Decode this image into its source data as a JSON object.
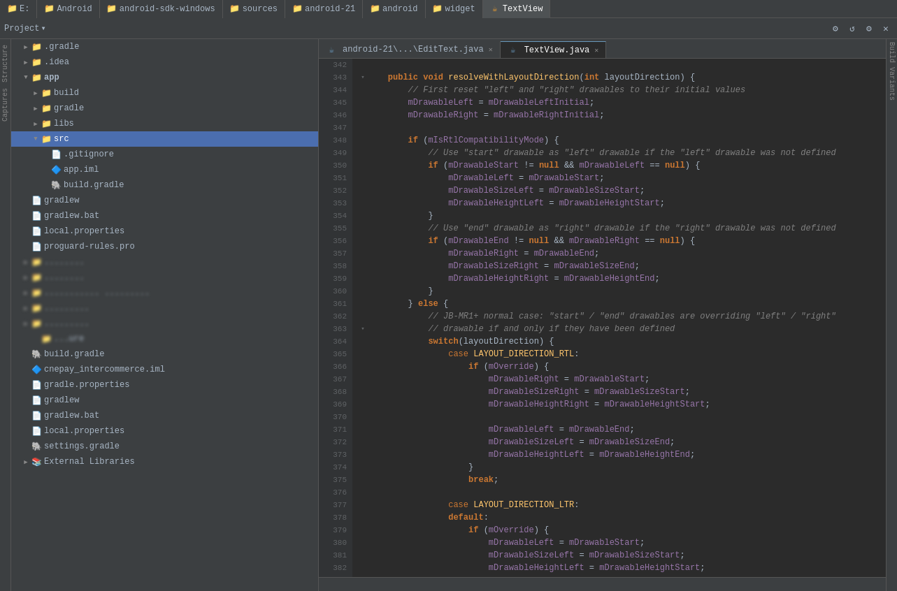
{
  "topTabs": [
    {
      "id": "e",
      "label": "E:",
      "icon": "android-folder-icon",
      "active": false,
      "closeable": false
    },
    {
      "id": "android",
      "label": "Android",
      "icon": "android-folder-icon",
      "active": false,
      "closeable": false
    },
    {
      "id": "android-sdk-windows",
      "label": "android-sdk-windows",
      "icon": "android-folder-icon",
      "active": false,
      "closeable": false
    },
    {
      "id": "sources",
      "label": "sources",
      "icon": "android-folder-icon",
      "active": false,
      "closeable": false
    },
    {
      "id": "android-21",
      "label": "android-21",
      "icon": "android-folder-icon",
      "active": false,
      "closeable": false
    },
    {
      "id": "android2",
      "label": "android",
      "icon": "android-folder-icon",
      "active": false,
      "closeable": false
    },
    {
      "id": "widget",
      "label": "widget",
      "icon": "android-folder-icon",
      "active": false,
      "closeable": false
    },
    {
      "id": "textview-main",
      "label": "TextView",
      "icon": "textview-icon",
      "active": true,
      "closeable": false
    }
  ],
  "toolbar": {
    "project_label": "Project",
    "dropdown_arrow": "▾",
    "icons": [
      "⚙",
      "↺",
      "⚙",
      "✕"
    ]
  },
  "editorTabs": [
    {
      "id": "edittext",
      "label": "android-21\\...\\EditText.java",
      "icon": "☕",
      "active": false,
      "closeable": true
    },
    {
      "id": "textview",
      "label": "TextView.java",
      "icon": "☕",
      "active": true,
      "closeable": true
    }
  ],
  "fileTree": {
    "items": [
      {
        "level": 1,
        "type": "folder",
        "name": ".gradle",
        "expanded": false,
        "icon": "folder"
      },
      {
        "level": 1,
        "type": "folder",
        "name": ".idea",
        "expanded": false,
        "icon": "folder"
      },
      {
        "level": 1,
        "type": "folder",
        "name": "app",
        "expanded": true,
        "icon": "folder",
        "bold": true
      },
      {
        "level": 2,
        "type": "folder",
        "name": "build",
        "expanded": false,
        "icon": "folder"
      },
      {
        "level": 2,
        "type": "folder",
        "name": "gradle",
        "expanded": false,
        "icon": "folder"
      },
      {
        "level": 2,
        "type": "folder",
        "name": "libs",
        "expanded": false,
        "icon": "folder"
      },
      {
        "level": 2,
        "type": "folder",
        "name": "src",
        "expanded": true,
        "icon": "folder-src",
        "selected": true
      },
      {
        "level": 3,
        "type": "file",
        "name": ".gitignore",
        "icon": "file"
      },
      {
        "level": 3,
        "type": "file",
        "name": "app.iml",
        "icon": "module"
      },
      {
        "level": 3,
        "type": "file",
        "name": "build.gradle",
        "icon": "gradle"
      },
      {
        "level": 1,
        "type": "file",
        "name": "gradlew",
        "icon": "file"
      },
      {
        "level": 1,
        "type": "file",
        "name": "gradlew.bat",
        "icon": "file"
      },
      {
        "level": 1,
        "type": "file",
        "name": "local.properties",
        "icon": "file"
      },
      {
        "level": 1,
        "type": "file",
        "name": "proguard-rules.pro",
        "icon": "file"
      },
      {
        "level": 1,
        "type": "folder",
        "name": "...",
        "expanded": false,
        "icon": "folder"
      },
      {
        "level": 1,
        "type": "folder",
        "name": "...",
        "expanded": false,
        "icon": "folder"
      },
      {
        "level": 1,
        "type": "folder",
        "name": "...",
        "expanded": false,
        "icon": "folder"
      },
      {
        "level": 1,
        "type": "folder",
        "name": "...",
        "expanded": false,
        "icon": "folder"
      },
      {
        "level": 1,
        "type": "folder",
        "name": "...",
        "expanded": false,
        "icon": "folder"
      },
      {
        "level": 2,
        "type": "folder",
        "name": "...ure",
        "expanded": false,
        "icon": "folder"
      },
      {
        "level": 1,
        "type": "file",
        "name": "build.gradle",
        "icon": "gradle"
      },
      {
        "level": 1,
        "type": "file",
        "name": "cnepay_intercommerce.iml",
        "icon": "module"
      },
      {
        "level": 1,
        "type": "file",
        "name": "gradle.properties",
        "icon": "file"
      },
      {
        "level": 1,
        "type": "file",
        "name": "gradlew",
        "icon": "file"
      },
      {
        "level": 1,
        "type": "file",
        "name": "gradlew.bat",
        "icon": "file"
      },
      {
        "level": 1,
        "type": "file",
        "name": "local.properties",
        "icon": "file"
      },
      {
        "level": 1,
        "type": "file",
        "name": "settings.gradle",
        "icon": "gradle"
      },
      {
        "level": 0,
        "type": "folder",
        "name": "External Libraries",
        "expanded": false,
        "icon": "folder"
      }
    ]
  },
  "codeLines": [
    {
      "num": 342,
      "fold": "",
      "content": ""
    },
    {
      "num": 343,
      "fold": "▾",
      "content": "    public void resolveWithLayoutDirection(int layoutDirection) {"
    },
    {
      "num": 344,
      "fold": "",
      "content": "        // First reset \"left\" and \"right\" drawables to their initial values"
    },
    {
      "num": 345,
      "fold": "",
      "content": "        mDrawableLeft = mDrawableLeftInitial;"
    },
    {
      "num": 346,
      "fold": "",
      "content": "        mDrawableRight = mDrawableRightInitial;"
    },
    {
      "num": 347,
      "fold": "",
      "content": ""
    },
    {
      "num": 348,
      "fold": "",
      "content": "        if (mIsRtlCompatibilityMode) {"
    },
    {
      "num": 349,
      "fold": "",
      "content": "            // Use \"start\" drawable as \"left\" drawable if the \"left\" drawable was not defined"
    },
    {
      "num": 350,
      "fold": "",
      "content": "            if (mDrawableStart != null && mDrawableLeft == null) {"
    },
    {
      "num": 351,
      "fold": "",
      "content": "                mDrawableLeft = mDrawableStart;"
    },
    {
      "num": 352,
      "fold": "",
      "content": "                mDrawableSizeLeft = mDrawableSizeStart;"
    },
    {
      "num": 353,
      "fold": "",
      "content": "                mDrawableHeightLeft = mDrawableHeightStart;"
    },
    {
      "num": 354,
      "fold": "",
      "content": "            }"
    },
    {
      "num": 355,
      "fold": "",
      "content": "            // Use \"end\" drawable as \"right\" drawable if the \"right\" drawable was not defined"
    },
    {
      "num": 356,
      "fold": "",
      "content": "            if (mDrawableEnd != null && mDrawableRight == null) {"
    },
    {
      "num": 357,
      "fold": "",
      "content": "                mDrawableRight = mDrawableEnd;"
    },
    {
      "num": 358,
      "fold": "",
      "content": "                mDrawableSizeRight = mDrawableSizeEnd;"
    },
    {
      "num": 359,
      "fold": "",
      "content": "                mDrawableHeightRight = mDrawableHeightEnd;"
    },
    {
      "num": 360,
      "fold": "",
      "content": "            }"
    },
    {
      "num": 361,
      "fold": "",
      "content": "        } else {"
    },
    {
      "num": 362,
      "fold": "",
      "content": "            // JB-MR1+ normal case: \"start\" / \"end\" drawables are overriding \"left\" / \"right\""
    },
    {
      "num": 363,
      "fold": "▾",
      "content": "            // drawable if and only if they have been defined"
    },
    {
      "num": 364,
      "fold": "",
      "content": "            switch(layoutDirection) {"
    },
    {
      "num": 365,
      "fold": "",
      "content": "                case LAYOUT_DIRECTION_RTL:"
    },
    {
      "num": 366,
      "fold": "",
      "content": "                    if (mOverride) {"
    },
    {
      "num": 367,
      "fold": "",
      "content": "                        mDrawableRight = mDrawableStart;"
    },
    {
      "num": 368,
      "fold": "",
      "content": "                        mDrawableSizeRight = mDrawableSizeStart;"
    },
    {
      "num": 369,
      "fold": "",
      "content": "                        mDrawableHeightRight = mDrawableHeightStart;"
    },
    {
      "num": 370,
      "fold": "",
      "content": ""
    },
    {
      "num": 371,
      "fold": "",
      "content": "                        mDrawableLeft = mDrawableEnd;"
    },
    {
      "num": 372,
      "fold": "",
      "content": "                        mDrawableSizeLeft = mDrawableSizeEnd;"
    },
    {
      "num": 373,
      "fold": "",
      "content": "                        mDrawableHeightLeft = mDrawableHeightEnd;"
    },
    {
      "num": 374,
      "fold": "",
      "content": "                    }"
    },
    {
      "num": 375,
      "fold": "",
      "content": "                    break;"
    },
    {
      "num": 376,
      "fold": "",
      "content": ""
    },
    {
      "num": 377,
      "fold": "",
      "content": "                case LAYOUT_DIRECTION_LTR:"
    },
    {
      "num": 378,
      "fold": "",
      "content": "                default:"
    },
    {
      "num": 379,
      "fold": "",
      "content": "                    if (mOverride) {"
    },
    {
      "num": 380,
      "fold": "",
      "content": "                        mDrawableLeft = mDrawableStart;"
    },
    {
      "num": 381,
      "fold": "",
      "content": "                        mDrawableSizeLeft = mDrawableSizeStart;"
    },
    {
      "num": 382,
      "fold": "",
      "content": "                        mDrawableHeightLeft = mDrawableHeightStart;"
    }
  ],
  "statusBar": {
    "text": ""
  },
  "sidebarLabels": {
    "structure": "Structure",
    "captures": "Captures",
    "build_variants": "Build Variants"
  }
}
